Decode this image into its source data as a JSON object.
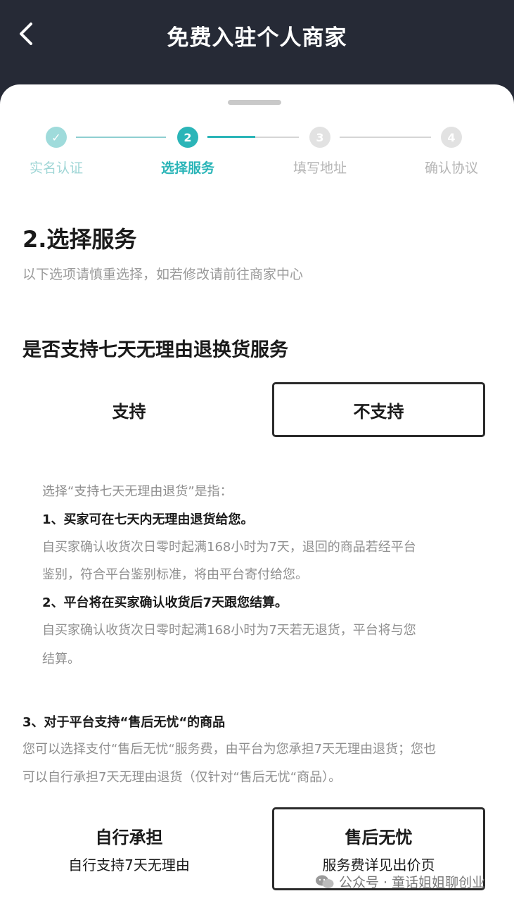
{
  "header": {
    "title": "免费入驻个人商家",
    "back_icon": "chevron-left-icon"
  },
  "stepper": {
    "steps": [
      {
        "number": "✓",
        "label": "实名认证",
        "state": "done"
      },
      {
        "number": "2",
        "label": "选择服务",
        "state": "active"
      },
      {
        "number": "3",
        "label": "填写地址",
        "state": "pending"
      },
      {
        "number": "4",
        "label": "确认协议",
        "state": "pending"
      }
    ],
    "accent": "#2bb5b8"
  },
  "section": {
    "title": "2.选择服务",
    "subtitle": "以下选项请慎重选择，如若修改请前往商家中心"
  },
  "question": {
    "text": "是否支持七天无理由退换货服务",
    "options": [
      {
        "label": "支持",
        "selected": false
      },
      {
        "label": "不支持",
        "selected": true
      }
    ]
  },
  "notes": {
    "intro": "选择“支持七天无理由退货”是指：",
    "item1_title": "1、买家可在七天内无理由退货给您。",
    "item1_line1": "自买家确认收货次日零时起满168小时为7天，退回的商品若经平台",
    "item1_line2": "鉴别，符合平台鉴别标准，将由平台寄付给您。",
    "item2_title": "2、平台将在买家确认收货后7天跟您结算。",
    "item2_line1": "自买家确认收货次日零时起满168小时为7天若无退货，平台将与您",
    "item2_line2": "结算。"
  },
  "note3": {
    "title": "3、对于平台支持“售后无忧“的商品",
    "line1": "您可以选择支付“售后无忧“服务费，由平台为您承担7天无理由退货；您也",
    "line2": "可以自行承担7天无理由退货（仅针对“售后无忧“商品）。"
  },
  "aftersale": {
    "options": [
      {
        "label": "自行承担",
        "sub": "自行支持7天无理由",
        "selected": false
      },
      {
        "label": "售后无忧",
        "sub": "服务费详见出价页",
        "selected": true
      }
    ]
  },
  "watermark": {
    "icon": "wechat-icon",
    "text": "公众号 · 童话姐姐聊创业"
  }
}
